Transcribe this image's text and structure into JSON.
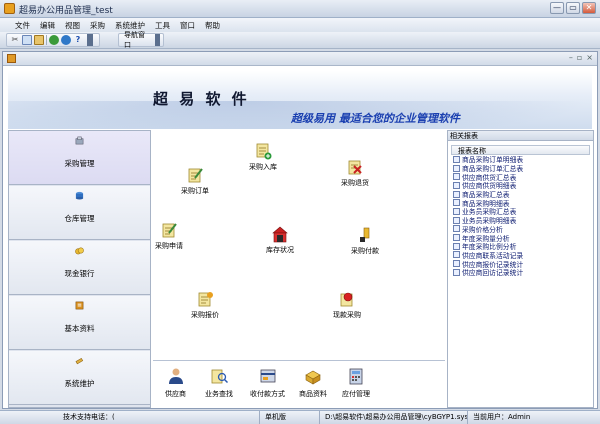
{
  "window": {
    "title": "超易办公用品管理_test"
  },
  "window_buttons": {
    "minimize": "—",
    "restore": "▭",
    "close": "✕"
  },
  "menu": [
    "文件",
    "编辑",
    "视图",
    "采购",
    "系统维护",
    "工具",
    "窗口",
    "帮助"
  ],
  "toolbar": {
    "nav_window_label": "导航窗口"
  },
  "child_buttons": {
    "minimize": "–",
    "restore": "▫",
    "close": "×"
  },
  "banner": {
    "title": "超 易 软 件",
    "slogan": "超级易用 最适合您的企业管理软件"
  },
  "nav": [
    {
      "label": "采购管理",
      "icon": "purchase-icon",
      "active": true
    },
    {
      "label": "仓库管理",
      "icon": "warehouse-icon"
    },
    {
      "label": "现金银行",
      "icon": "cash-bank-icon"
    },
    {
      "label": "基本资料",
      "icon": "basic-data-icon"
    },
    {
      "label": "系统维护",
      "icon": "system-maintenance-icon"
    }
  ],
  "flow": {
    "purchase_in": "采购入库",
    "purchase_order": "采购订单",
    "purchase_return": "采购退货",
    "purchase_request": "采购申请",
    "stock_status": "库存状况",
    "purchase_payment": "采购付款",
    "purchase_quote": "采购报价",
    "cash_purchase": "现款采购"
  },
  "bottom_bar": [
    "供应商",
    "业务查找",
    "收付款方式",
    "商品资料",
    "应付管理"
  ],
  "right_panel": {
    "header": "相关报表",
    "column": "报表名称",
    "reports": [
      "商品采购订单明细表",
      "商品采购订单汇总表",
      "供应商供货汇总表",
      "供应商供货明细表",
      "商品采购汇总表",
      "商品采购明细表",
      "业务员采购汇总表",
      "业务员采购明细表",
      "采购价格分析",
      "年度采购量分析",
      "年度采购比例分析",
      "供应商联系活动记录",
      "供应商报价记录统计",
      "供应商回访记录统计"
    ]
  },
  "statusbar": {
    "support": "技术支持电话：(",
    "mode": "单机版",
    "path": "D:\\超易软件\\超易办公用品管理\\cyBGYP1.sys",
    "user": "当前用户：Admin"
  }
}
